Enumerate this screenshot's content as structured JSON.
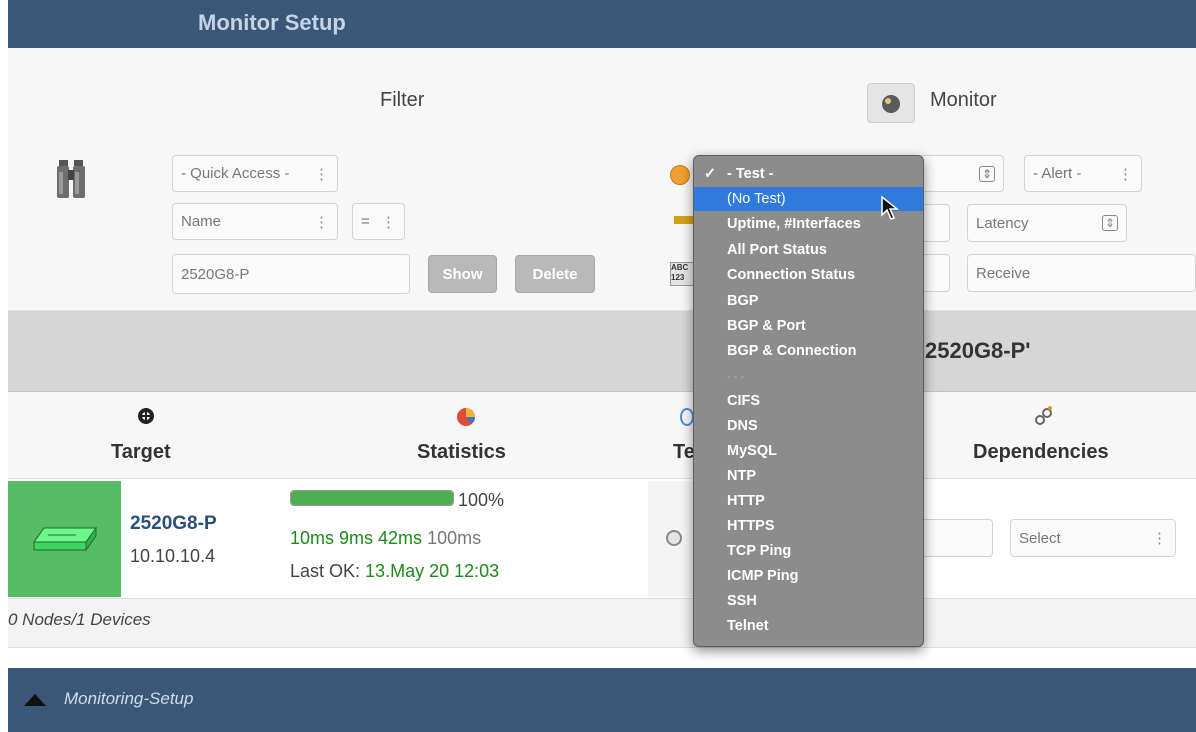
{
  "header": {
    "title": "Monitor Setup"
  },
  "filter": {
    "label": "Filter",
    "quick_access": "- Quick Access -",
    "field": "Name",
    "operator": "=",
    "value": "2520G8-P",
    "show_label": "Show",
    "delete_label": "Delete"
  },
  "monitor": {
    "label": "Monitor",
    "alert": "- Alert -",
    "latency": "Latency",
    "receive": "Receive"
  },
  "banner": {
    "text": "2520G8-P'"
  },
  "columns": {
    "target": "Target",
    "statistics": "Statistics",
    "test_partial": "Te",
    "dependencies": "Dependencies"
  },
  "device": {
    "name": "2520G8-P",
    "ip": "10.10.10.4",
    "uptime_percent": 100,
    "uptime_label": "100%",
    "latency_green": "10ms 9ms 42ms",
    "latency_gray": "100ms",
    "last_ok_label": "Last OK:",
    "last_ok_value": "13.May 20 12:03",
    "select": "Select"
  },
  "count": "0 Nodes/1 Devices",
  "footer": {
    "label": "Monitoring-Setup"
  },
  "test_menu": {
    "items": [
      "- Test -",
      "(No Test)",
      "Uptime, #Interfaces",
      "All Port Status",
      "Connection Status",
      "BGP",
      "BGP & Port",
      "BGP & Connection",
      "- - -",
      "CIFS",
      "DNS",
      "MySQL",
      "NTP",
      "HTTP",
      "HTTPS",
      "TCP Ping",
      "ICMP Ping",
      "SSH",
      "Telnet"
    ],
    "checked": "- Test -",
    "highlighted": "(No Test)"
  },
  "colors": {
    "header": "#3a5778",
    "status_ok": "#56bc66",
    "link": "#2c4f7c",
    "highlight": "#2e7bdd",
    "latency_ok": "#1d8a1d"
  }
}
